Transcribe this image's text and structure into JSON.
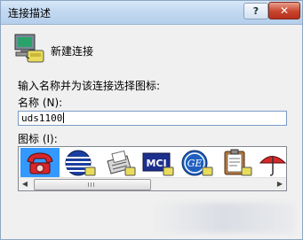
{
  "window": {
    "title": "连接描述",
    "help_label": "?",
    "close_label": "✕"
  },
  "header": {
    "new_connection_label": "新建连接"
  },
  "form": {
    "prompt": "输入名称并为该连接选择图标:",
    "name_label": "名称 (N):",
    "name_value": "uds1100",
    "icon_label": "图标 (I):"
  },
  "icons": [
    {
      "name": "telephone-icon",
      "selected": true
    },
    {
      "name": "globe-icon",
      "selected": false
    },
    {
      "name": "fax-icon",
      "selected": false
    },
    {
      "name": "mci-icon",
      "selected": false
    },
    {
      "name": "ge-icon",
      "selected": false
    },
    {
      "name": "clipboard-icon",
      "selected": false
    },
    {
      "name": "umbrella-icon",
      "selected": false
    }
  ],
  "colors": {
    "selection": "#3399ff",
    "close": "#c8442d"
  }
}
